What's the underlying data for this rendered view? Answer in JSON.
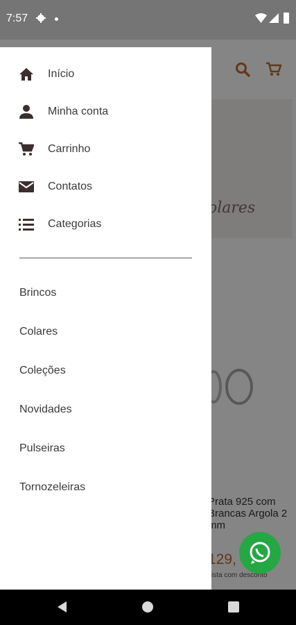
{
  "status_bar": {
    "time": "7:57"
  },
  "drawer": {
    "menu": [
      {
        "label": "Início",
        "icon": "home-icon"
      },
      {
        "label": "Minha conta",
        "icon": "person-icon"
      },
      {
        "label": "Carrinho",
        "icon": "cart-icon"
      },
      {
        "label": "Contatos",
        "icon": "mail-icon"
      },
      {
        "label": "Categorias",
        "icon": "list-icon"
      }
    ],
    "categories": [
      "Brincos",
      "Colares",
      "Coleções",
      "Novidades",
      "Pulseiras",
      "Tornozeleiras"
    ]
  },
  "background": {
    "banner_text": "olares",
    "product_title": "Prata 925 com Brancas Argola 2 mm",
    "product_price": "129,",
    "product_sub": "vista com desconto"
  },
  "colors": {
    "accent": "#c06a2e",
    "whatsapp": "#25a844",
    "icon": "#3a2e2e"
  }
}
